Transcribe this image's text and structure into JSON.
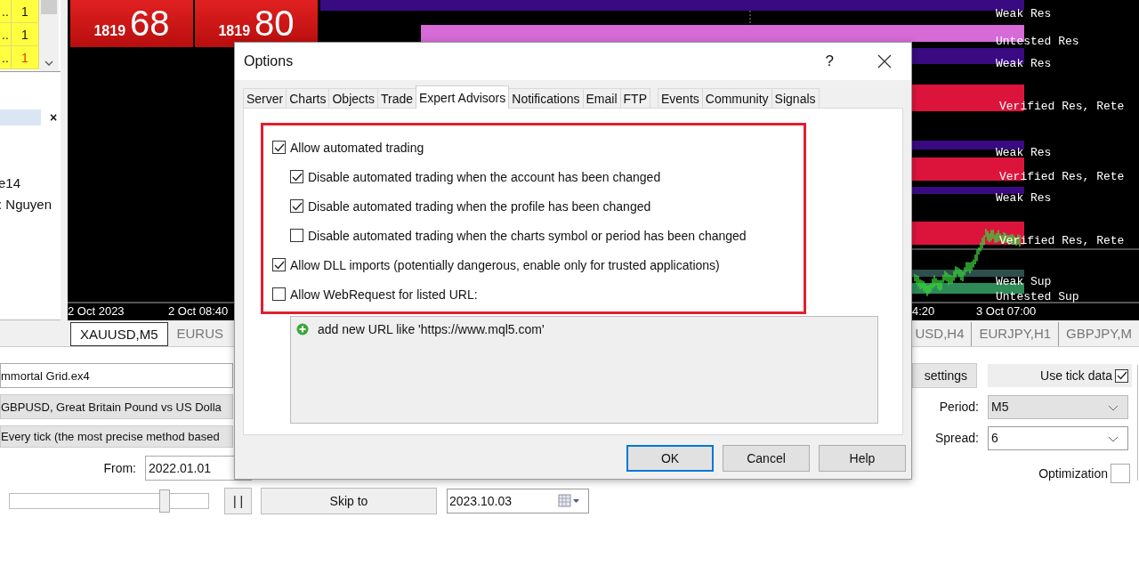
{
  "left_panel": {
    "rows": [
      {
        "col_1": "..",
        "col_2": "1",
        "alert": false
      },
      {
        "col_1": "..",
        "col_2": "1",
        "alert": false
      },
      {
        "col_1": "..",
        "col_2": "1",
        "alert": true
      }
    ],
    "close": "×",
    "lines": [
      "e14",
      ": Nguyen"
    ]
  },
  "price_boxes": [
    {
      "small": "1819",
      "big": "68"
    },
    {
      "small": "1819",
      "big": "80"
    }
  ],
  "chart": {
    "zones": [
      {
        "label": "Weak Res",
        "color": "#3a0a82"
      },
      {
        "label": "Untested Res",
        "color": "#d66ad6"
      },
      {
        "label": "Weak Res",
        "color": "#3a0a82"
      },
      {
        "label": "Verified Res, Rete",
        "color": "#dc143c"
      },
      {
        "label": "Weak Res",
        "color": "#3a0a82"
      },
      {
        "label": "Verified Res, Rete",
        "color": "#dc143c"
      },
      {
        "label": "Weak Res",
        "color": "#3a0a82"
      },
      {
        "label": "Verified Res, Rete",
        "color": "#dc143c"
      },
      {
        "label": "Weak Sup",
        "color": "#2f4f4f"
      },
      {
        "label": "Untested Sup",
        "color": "#2e8b57"
      }
    ],
    "time_labels": [
      "2 Oct 2023",
      "2 Oct 08:40",
      "4:20",
      "3 Oct 07:00"
    ]
  },
  "chart_tabs": [
    {
      "label": "XAUUSD,M5",
      "selected": true
    },
    {
      "label": "EURUS",
      "selected": false
    },
    {
      "label": "USD,H4",
      "selected": false
    },
    {
      "label": "EURJPY,H1",
      "selected": false
    },
    {
      "label": "GBPJPY,M",
      "selected": false
    }
  ],
  "tester": {
    "expert": "mmortal Grid.ex4",
    "symbol": "GBPUSD, Great Britain Pound vs US Dolla",
    "model": "Every tick (the most precise method based",
    "from_label": "From:",
    "from": "2022.01.01",
    "slider": {
      "level": 0.78
    },
    "pause": "| |",
    "skip_button": "Skip to",
    "skip_date": "2023.10.03",
    "settings_button": "settings",
    "use_tick_data": {
      "label": "Use tick data",
      "checked": true
    },
    "period_label": "Period:",
    "period": "M5",
    "spread_label": "Spread:",
    "spread": "6",
    "optimization": {
      "label": "Optimization",
      "checked": false
    }
  },
  "dialog": {
    "title": "Options",
    "help": "?",
    "tabs": [
      {
        "label": "Server",
        "selected": false
      },
      {
        "label": "Charts",
        "selected": false
      },
      {
        "label": "Objects",
        "selected": false
      },
      {
        "label": "Trade",
        "selected": false
      },
      {
        "label": "Expert Advisors",
        "selected": true
      },
      {
        "label": "Notifications",
        "selected": false
      },
      {
        "label": "Email",
        "selected": false
      },
      {
        "label": "FTP",
        "selected": false
      },
      {
        "label": "Events",
        "selected": false
      },
      {
        "label": "Community",
        "selected": false
      },
      {
        "label": "Signals",
        "selected": false
      }
    ],
    "options": [
      {
        "label": "Allow automated trading",
        "checked": true,
        "children": [
          {
            "label": "Disable automated trading when the account has been changed",
            "checked": true
          },
          {
            "label": "Disable automated trading when the profile has been changed",
            "checked": true
          },
          {
            "label": "Disable automated trading when the charts symbol or period has been changed",
            "checked": false
          }
        ]
      },
      {
        "label": "Allow DLL imports (potentially dangerous, enable only for trusted applications)",
        "checked": true
      },
      {
        "label": "Allow WebRequest for listed URL:",
        "checked": false
      }
    ],
    "url_list": {
      "add_text": "add new URL like 'https://www.mql5.com'"
    },
    "buttons": [
      {
        "label": "OK",
        "default": true
      },
      {
        "label": "Cancel",
        "default": false
      },
      {
        "label": "Help",
        "default": false
      }
    ]
  }
}
